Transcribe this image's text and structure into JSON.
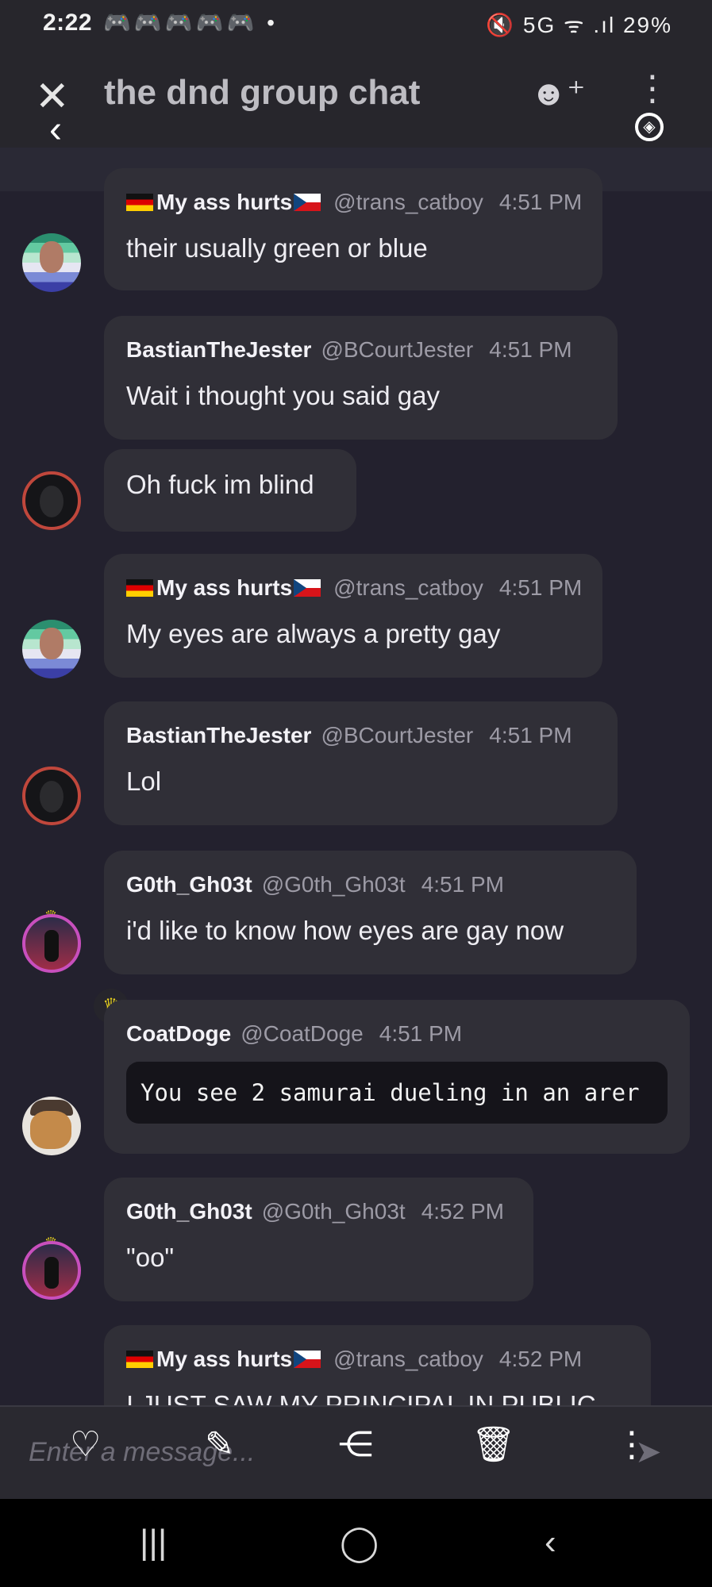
{
  "status_bar": {
    "time": "2:22",
    "notification_icons": "🎮🎮🎮🎮🎮 •",
    "system_icons": "🔇 5G ᯤ .ıl 29%"
  },
  "header": {
    "title": "the dnd group chat",
    "close_icon": "✕",
    "back_icon": "‹",
    "add_member_icon": "☻⁺",
    "menu_icon": "⋮",
    "sync_icon": "◈"
  },
  "messages": [
    {
      "name": "My ass hurts",
      "handle": "@trans_catboy",
      "time": "4:51 PM",
      "text": "their usually green or blue"
    },
    {
      "name": "BastianTheJester",
      "handle": "@BCourtJester",
      "time": "4:51 PM",
      "text": "Wait i thought you said gay"
    },
    {
      "text": "Oh fuck im blind"
    },
    {
      "name": "My ass hurts",
      "handle": "@trans_catboy",
      "time": "4:51 PM",
      "text": "My eyes are always a pretty gay"
    },
    {
      "name": "BastianTheJester",
      "handle": "@BCourtJester",
      "time": "4:51 PM",
      "text": "Lol"
    },
    {
      "name": "G0th_Gh03t",
      "handle": "@G0th_Gh03t",
      "time": "4:51 PM",
      "text": "i'd like to know how eyes are gay now"
    },
    {
      "name": "CoatDoge",
      "handle": "@CoatDoge",
      "time": "4:51 PM",
      "code": "You see 2 samurai dueling in an arer"
    },
    {
      "name": "G0th_Gh03t",
      "handle": "@G0th_Gh03t",
      "time": "4:52 PM",
      "text": "\"oo\""
    },
    {
      "name": "My ass hurts",
      "handle": "@trans_catboy",
      "time": "4:52 PM",
      "text": "I JUST SAW MY PRINCIPAL IN PUBLIC"
    }
  ],
  "composer": {
    "placeholder": "Enter a message...",
    "send_icon": "➤"
  },
  "action_bar": {
    "like_icon": "♡",
    "edit_icon": "✎",
    "share_icon": "⋲",
    "delete_icon": "🗑",
    "more_icon": "⋮"
  },
  "nav_bar": {
    "recents_icon": "|||",
    "home_icon": "◯",
    "back_icon": "‹"
  },
  "crown_icon": "♛"
}
